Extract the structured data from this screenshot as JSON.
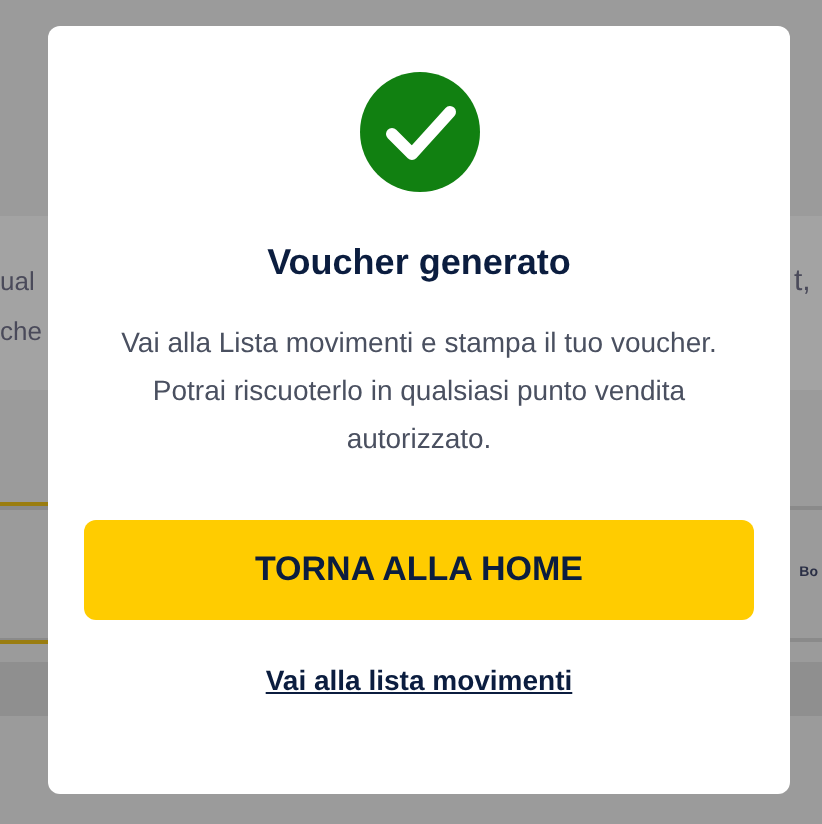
{
  "background": {
    "left_texts": [
      "ual",
      "che"
    ],
    "right_texts": [
      "t,"
    ],
    "right_label": "Bo"
  },
  "dialog": {
    "title": "Voucher generato",
    "message": "Vai alla Lista movimenti e stampa il tuo voucher. Potrai riscuoterlo in qualsiasi punto vendita autorizzato.",
    "primary_button": "TORNA ALLA HOME",
    "link": "Vai alla lista movimenti"
  }
}
